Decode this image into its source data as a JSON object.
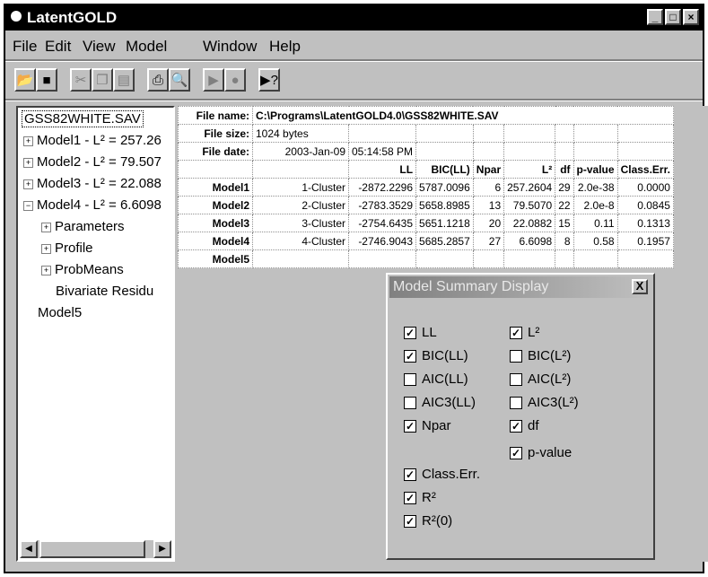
{
  "app": {
    "title": "LatentGOLD"
  },
  "menu": [
    "File",
    "Edit",
    "View",
    "Model",
    "Window",
    "Help"
  ],
  "toolbar": [
    "open-icon",
    "save-icon",
    "cut-icon",
    "copy-icon",
    "paste-icon",
    "print-icon",
    "preview-icon",
    "play-icon",
    "stop-icon",
    "help-icon"
  ],
  "tree": {
    "root": "GSS82WHITE.SAV",
    "items": [
      {
        "label": "Model1 - L² = 257.26",
        "toggle": "+"
      },
      {
        "label": "Model2 - L² = 79.507",
        "toggle": "+"
      },
      {
        "label": "Model3 - L² = 22.088",
        "toggle": "+"
      },
      {
        "label": "Model4 - L² = 6.6098",
        "toggle": "−"
      },
      {
        "label": "Parameters",
        "toggle": "+"
      },
      {
        "label": "Profile",
        "toggle": "+"
      },
      {
        "label": "ProbMeans",
        "toggle": "+"
      },
      {
        "label": "Bivariate Residu",
        "toggle": ""
      },
      {
        "label": "Model5",
        "toggle": ""
      }
    ]
  },
  "fileinfo": {
    "name_label": "File name:",
    "name": "C:\\Programs\\LatentGOLD4.0\\GSS82WHITE.SAV",
    "size_label": "File size:",
    "size": "1024 bytes",
    "date_label": "File date:",
    "date": "2003-Jan-09",
    "time": "05:14:58 PM"
  },
  "table": {
    "columns": [
      "LL",
      "BIC(LL)",
      "Npar",
      "L²",
      "df",
      "p-value",
      "Class.Err."
    ],
    "rows": [
      {
        "model": "Model1",
        "cluster": "1-Cluster",
        "values": [
          "-2872.2296",
          "5787.0096",
          "6",
          "257.2604",
          "29",
          "2.0e-38",
          "0.0000"
        ]
      },
      {
        "model": "Model2",
        "cluster": "2-Cluster",
        "values": [
          "-2783.3529",
          "5658.8985",
          "13",
          "79.5070",
          "22",
          "2.0e-8",
          "0.0845"
        ]
      },
      {
        "model": "Model3",
        "cluster": "3-Cluster",
        "values": [
          "-2754.6435",
          "5651.1218",
          "20",
          "22.0882",
          "15",
          "0.11",
          "0.1313"
        ]
      },
      {
        "model": "Model4",
        "cluster": "4-Cluster",
        "values": [
          "-2746.9043",
          "5685.2857",
          "27",
          "6.6098",
          "8",
          "0.58",
          "0.1957"
        ]
      },
      {
        "model": "Model5",
        "cluster": "",
        "values": [
          "",
          "",
          "",
          "",
          "",
          "",
          ""
        ]
      }
    ]
  },
  "dialog": {
    "title": "Model Summary Display",
    "close": "X",
    "left": [
      {
        "label": "LL",
        "checked": true
      },
      {
        "label": "BIC(LL)",
        "checked": true
      },
      {
        "label": "AIC(LL)",
        "checked": false
      },
      {
        "label": "AIC3(LL)",
        "checked": false
      },
      {
        "label": "Npar",
        "checked": true
      },
      {
        "label": "Class.Err.",
        "checked": true
      },
      {
        "label": "R²",
        "checked": true
      },
      {
        "label": "R²(0)",
        "checked": true
      }
    ],
    "right": [
      {
        "label": "L²",
        "checked": true
      },
      {
        "label": "BIC(L²)",
        "checked": false
      },
      {
        "label": "AIC(L²)",
        "checked": false
      },
      {
        "label": "AIC3(L²)",
        "checked": false
      },
      {
        "label": "df",
        "checked": true
      },
      {
        "label": "p-value",
        "checked": true
      }
    ]
  }
}
